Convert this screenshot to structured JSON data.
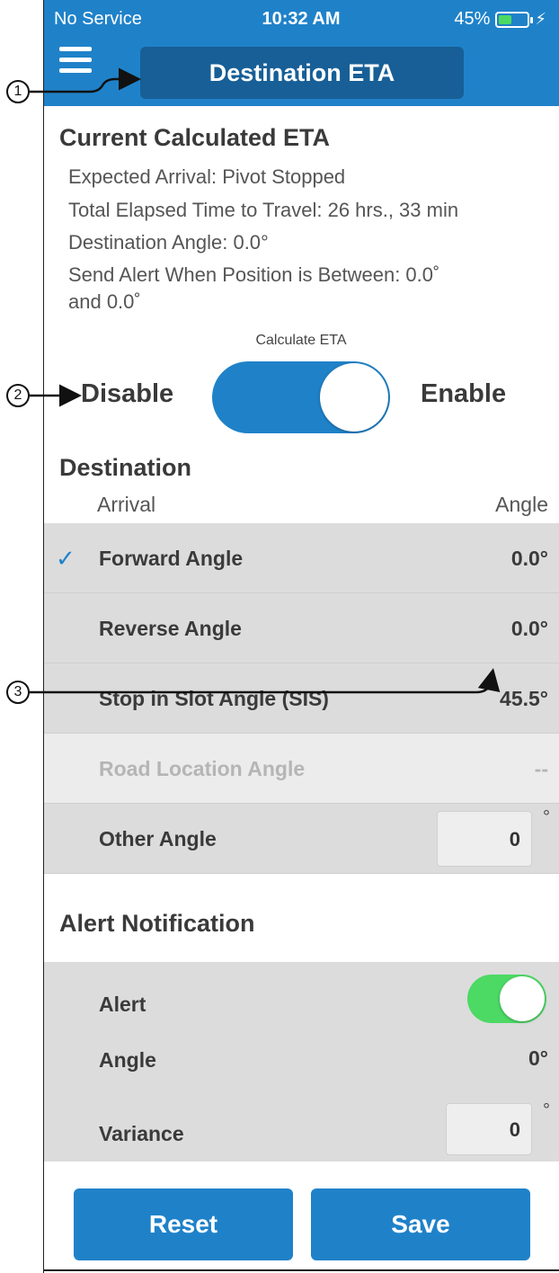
{
  "status": {
    "carrier": "No Service",
    "time": "10:32 AM",
    "battery_pct": "45%",
    "battery_level": 0.45
  },
  "header": {
    "title": "Destination ETA"
  },
  "current": {
    "heading": "Current Calculated ETA",
    "expected_arrival": "Expected Arrival: Pivot Stopped",
    "elapsed": "Total Elapsed Time to Travel: 26 hrs., 33 min",
    "dest_angle": "Destination Angle: 0.0°",
    "alert_line1": "Send Alert When Position is Between: 0.0˚",
    "alert_line2": "and 0.0˚"
  },
  "calc": {
    "label": "Calculate ETA",
    "disable": "Disable",
    "enable": "Enable",
    "state": "on"
  },
  "destination": {
    "heading": "Destination",
    "col_arrival": "Arrival",
    "col_angle": "Angle",
    "rows": [
      {
        "label": "Forward Angle",
        "value": "0.0°",
        "checked": true
      },
      {
        "label": "Reverse Angle",
        "value": "0.0°"
      },
      {
        "label": "Stop in Slot Angle (SIS)",
        "value": "45.5°"
      },
      {
        "label": "Road Location Angle",
        "value": "--",
        "disabled": true
      },
      {
        "label": "Other Angle",
        "input_value": "0",
        "unit": "°"
      }
    ]
  },
  "alert": {
    "heading": "Alert Notification",
    "alert_label": "Alert",
    "alert_state": "on",
    "angle_label": "Angle",
    "angle_value": "0°",
    "variance_label": "Variance",
    "variance_value": "0",
    "variance_unit": "°"
  },
  "buttons": {
    "reset": "Reset",
    "save": "Save"
  },
  "callouts": [
    "1",
    "2",
    "3"
  ],
  "colors": {
    "primary": "#1f82c9",
    "title_pill": "#175f96",
    "toggle_green": "#4cd964",
    "row_gray": "#dcdcdc"
  }
}
